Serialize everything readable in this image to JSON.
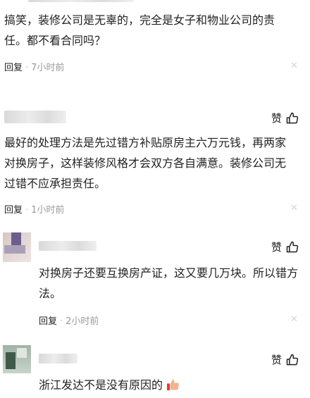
{
  "comments": [
    {
      "text": "搞笑，装修公司是无辜的，完全是女子和物业公司的责任。都不看合同吗？",
      "reply_label": "回复",
      "separator": "·",
      "time": "7小时前"
    },
    {
      "like_label": "赞",
      "text": "最好的处理方法是先过错方补贴原房主六万元钱，再两家对换房子，这样装修风格才会双方各自满意。装修公司无过错不应承担责任。",
      "reply_label": "回复",
      "separator": "·",
      "time": "1小时前"
    }
  ],
  "replies": [
    {
      "like_label": "赞",
      "text": "对换房子还要互换房产证，这又要几万块。所以错方法。",
      "reply_label": "回复",
      "separator": "·",
      "time": "2小时前"
    },
    {
      "like_label": "赞",
      "text": "浙江发达不是没有原因的"
    }
  ],
  "icons": {
    "like": "thumbs-up-icon",
    "close": "close-icon",
    "emoji": "thumbs-up-emoji-icon"
  },
  "colors": {
    "text": "#222222",
    "muted": "#9a9a9a",
    "close": "#d6d6d6"
  }
}
